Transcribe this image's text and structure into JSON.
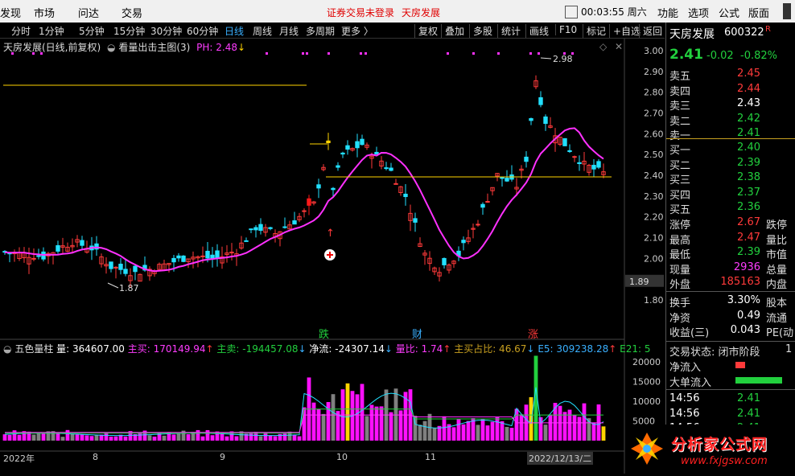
{
  "topbar": {
    "menu": [
      "发现",
      "市场",
      "问达",
      "交易"
    ],
    "notice_login": "证券交易未登录",
    "notice_stock": "天房发展",
    "clock": "00:03:55 周六",
    "menu_right": [
      "功能",
      "选项",
      "公式",
      "版面"
    ]
  },
  "toolbar": {
    "periods": [
      "分时",
      "1分钟",
      "5分钟",
      "15分钟",
      "30分钟",
      "60分钟",
      "日线",
      "周线",
      "月线",
      "多周期",
      "更多 〉"
    ],
    "selected": "日线",
    "buttons": [
      "复权",
      "叠加",
      "多股",
      "统计",
      "画线",
      "F10",
      "标记",
      "+自选",
      "返回"
    ]
  },
  "main_chart": {
    "title": "天房发展(日线,前复权)",
    "indicator_name": "看量出击主图(3)",
    "ph_label": "PH: 2.48",
    "high_marker": "2.98",
    "low_marker": "1.87",
    "price_label": "1.89",
    "signals": [
      "跌",
      "财",
      "涨"
    ],
    "y_ticks": [
      "3.00",
      "2.90",
      "2.80",
      "2.70",
      "2.60",
      "2.50",
      "2.40",
      "2.30",
      "2.20",
      "2.10",
      "2.00",
      "1.90",
      "1.80"
    ]
  },
  "volume_chart": {
    "name": "五色量柱",
    "vol": "量: 364607.00",
    "zhu_mai": "主买: 170149.94",
    "zhu_mai_2": "主卖: -194457.08",
    "jing_liu": "净流: -24307.14",
    "liang_bi": "量比: 1.74",
    "zhan_bi": "主买占比: 46.67",
    "e5": "E5: 309238.28",
    "e21": "E21: 5",
    "y_ticks": [
      "20000",
      "15000",
      "10000",
      "5000"
    ]
  },
  "x_axis": {
    "labels": [
      "2022年",
      "8",
      "9",
      "10",
      "11",
      "2022/12/13/二"
    ]
  },
  "quote": {
    "name": "天房发展",
    "code": "600322",
    "flag": "R",
    "price": "2.41",
    "change": "-0.02",
    "pct": "-0.82%",
    "sell": [
      {
        "l": "卖五",
        "v": "2.45"
      },
      {
        "l": "卖四",
        "v": "2.44"
      },
      {
        "l": "卖三",
        "v": "2.43"
      },
      {
        "l": "卖二",
        "v": "2.42"
      },
      {
        "l": "卖一",
        "v": "2.41"
      }
    ],
    "buy": [
      {
        "l": "买一",
        "v": "2.40"
      },
      {
        "l": "买二",
        "v": "2.39"
      },
      {
        "l": "买三",
        "v": "2.38"
      },
      {
        "l": "买四",
        "v": "2.37"
      },
      {
        "l": "买五",
        "v": "2.36"
      }
    ],
    "stats": [
      {
        "l": "涨停",
        "v": "2.67",
        "l2": "跌停"
      },
      {
        "l": "最高",
        "v": "2.47",
        "l2": "量比"
      },
      {
        "l": "最低",
        "v": "2.39",
        "l2": "市值"
      },
      {
        "l": "现量",
        "v": "2936",
        "l2": "总量"
      },
      {
        "l": "外盘",
        "v": "185163",
        "l2": "内盘"
      }
    ],
    "stats2": [
      {
        "l": "换手",
        "v": "3.30%",
        "l2": "股本"
      },
      {
        "l": "净资",
        "v": "0.49",
        "l2": "流通"
      },
      {
        "l": "收益(三)",
        "v": "0.043",
        "l2": "PE(动"
      }
    ],
    "status": "交易状态: 闭市阶段",
    "status_tail": "1",
    "net_flow": "净流入",
    "big_flow": "大单流入",
    "ticks": [
      {
        "t": "14:56",
        "p": "2.41"
      },
      {
        "t": "14:56",
        "p": "2.41"
      },
      {
        "t": "14:56",
        "p": "2.41"
      }
    ]
  },
  "watermark": {
    "text": "分析家公式网",
    "url": "www.fxjgsw.com"
  },
  "colors": {
    "up": "#ff3a3a",
    "down": "#22e0ff",
    "ma": "#ff30ff",
    "yellow": "#ffd400",
    "green": "#22d03e"
  }
}
